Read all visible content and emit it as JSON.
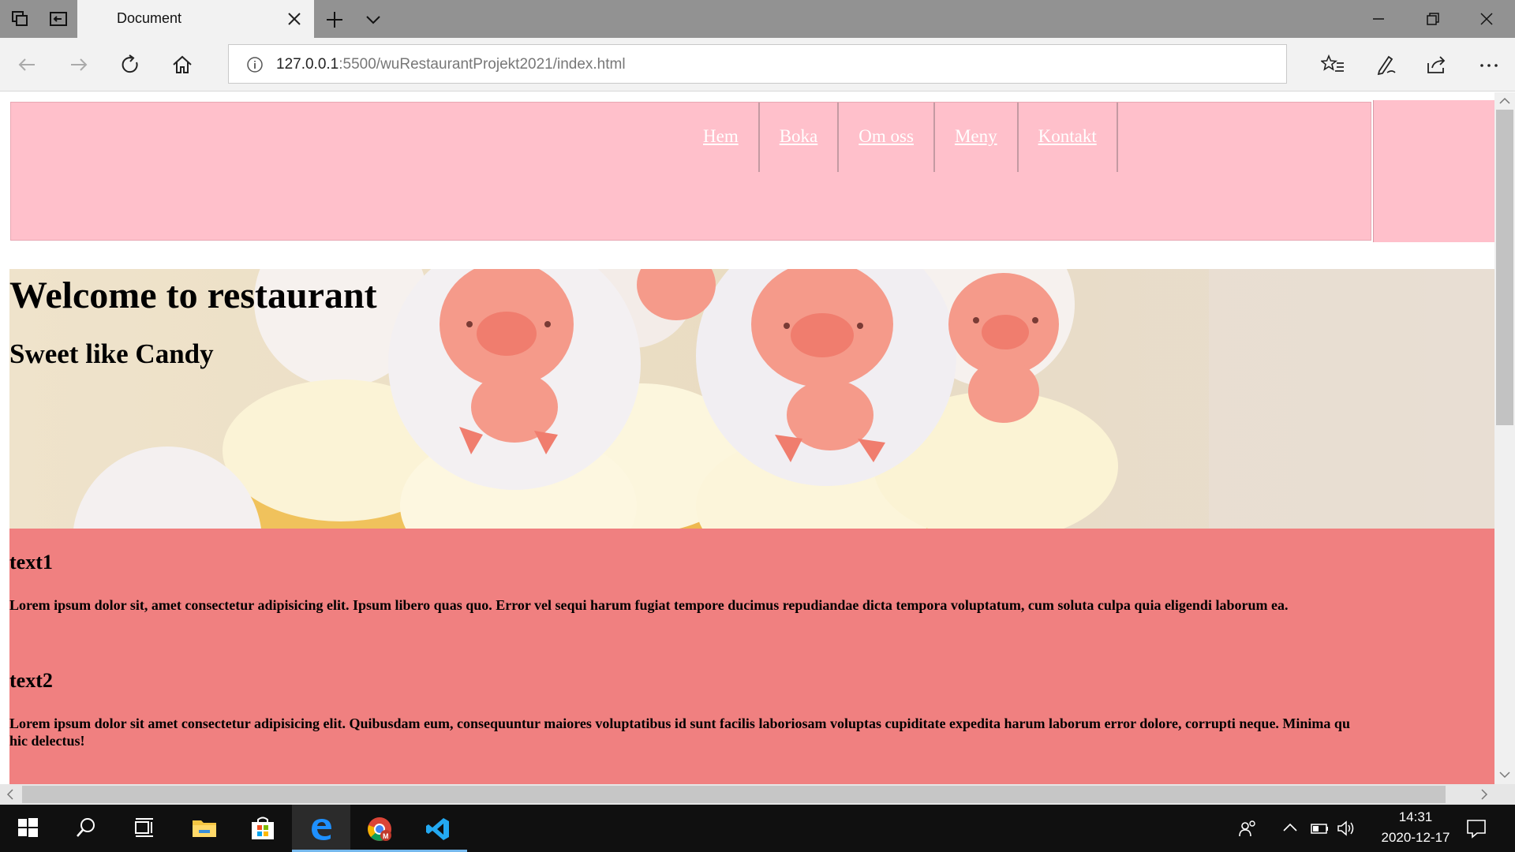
{
  "browser": {
    "tab_title": "Document",
    "url_host": "127.0.0.1",
    "url_rest": ":5500/wuRestaurantProjekt2021/index.html"
  },
  "page": {
    "nav": [
      "Hem",
      "Boka",
      "Om oss",
      "Meny",
      "Kontakt"
    ],
    "hero_title": "Welcome to restaurant",
    "hero_subtitle": "Sweet like Candy",
    "sections": [
      {
        "title": "text1",
        "body": "Lorem ipsum dolor sit, amet consectetur adipisicing elit. Ipsum libero quas quo. Error vel sequi harum fugiat tempore ducimus repudiandae dicta tempora voluptatum, cum soluta culpa quia eligendi laborum ea."
      },
      {
        "title": "text2",
        "body": "Lorem ipsum dolor sit amet consectetur adipisicing elit. Quibusdam eum, consequuntur maiores voluptatibus id sunt facilis laboriosam voluptas cupiditate expedita harum laborum error dolore, corrupti neque. Minima qu",
        "body_line2": "hic delectus!"
      }
    ]
  },
  "taskbar": {
    "time": "14:31",
    "date": "2020-12-17"
  },
  "colors": {
    "header_pink": "#ffc0cb",
    "content_coral": "#f08080",
    "tabbar_gray": "#929292",
    "taskbar_black": "#101010"
  },
  "icons": [
    "tab-actions-icon",
    "set-aside-tabs-icon",
    "close-icon",
    "plus-icon",
    "chevron-down-icon",
    "minimize-icon",
    "restore-icon",
    "back-icon",
    "forward-icon",
    "refresh-icon",
    "home-icon",
    "info-icon",
    "favorites-icon",
    "pen-icon",
    "share-icon",
    "more-icon",
    "windows-icon",
    "search-icon",
    "task-view-icon",
    "file-explorer-icon",
    "store-icon",
    "edge-icon",
    "chrome-icon",
    "vscode-icon",
    "people-icon",
    "chevron-up-icon",
    "battery-icon",
    "speaker-icon",
    "notification-icon"
  ]
}
